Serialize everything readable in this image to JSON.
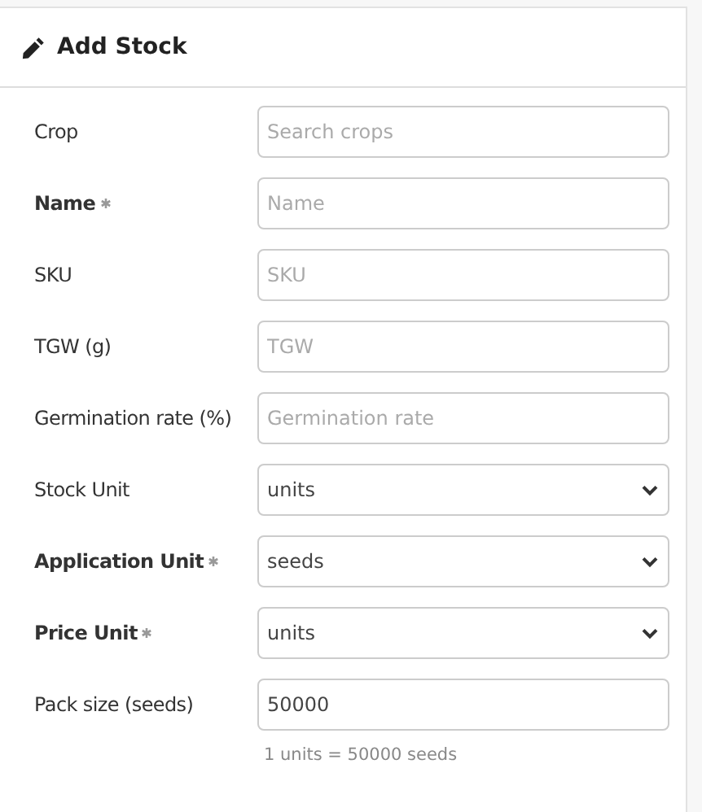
{
  "card": {
    "title": "Add Stock"
  },
  "fields": [
    {
      "label": "Crop",
      "required": false,
      "kind": "text",
      "placeholder": "Search crops"
    },
    {
      "label": "Name",
      "required": true,
      "kind": "text",
      "placeholder": "Name"
    },
    {
      "label": "SKU",
      "required": false,
      "kind": "text",
      "placeholder": "SKU"
    },
    {
      "label": "TGW (g)",
      "required": false,
      "kind": "text",
      "placeholder": "TGW"
    },
    {
      "label": "Germination rate (%)",
      "required": false,
      "kind": "text",
      "placeholder": "Germination rate"
    },
    {
      "label": "Stock Unit",
      "required": false,
      "kind": "select",
      "value": "units"
    },
    {
      "label": "Application Unit",
      "required": true,
      "kind": "select",
      "value": "seeds"
    },
    {
      "label": "Price Unit",
      "required": true,
      "kind": "select",
      "value": "units"
    },
    {
      "label": "Pack size (seeds)",
      "required": false,
      "kind": "text",
      "value": "50000",
      "help": "1 units = 50000 seeds"
    }
  ]
}
